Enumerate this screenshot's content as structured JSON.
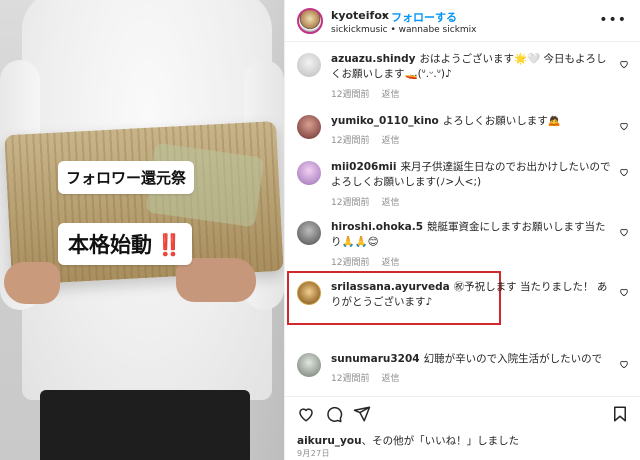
{
  "media": {
    "caption_line1": "フォロワー還元祭",
    "caption_line2": "本格始動",
    "caption_mark": "‼️"
  },
  "header": {
    "username": "kyoteifox",
    "separator": "•",
    "follow_label": "フォローする",
    "subtitle": "sickickmusic • wannabe sickmix",
    "menu_icon": "ellipsis-icon"
  },
  "comments": [
    {
      "username": "azuazu.shindy",
      "text": "おはようございます🌟🤍 今日もよろしくお願いします🚤(ᐡ.ᵕ.ᐡ)♪",
      "time": "12週間前",
      "reply": "返信",
      "avatar_color": "#d9d9d9"
    },
    {
      "username": "yumiko_0110_kino",
      "text": "よろしくお願いします🙇",
      "time": "12週間前",
      "reply": "返信",
      "avatar_color": "#8a4a4a"
    },
    {
      "username": "mii0206mii",
      "text": "来月子供達誕生日なのでお出かけしたいのでよろしくお願いします(ﾉ>人<;)",
      "time": "12週間前",
      "reply": "返信",
      "avatar_color": "#c7a0d8"
    },
    {
      "username": "hiroshi.ohoka.5",
      "text": "競艇軍資金にしますお願いします当たり🙏🙏😊",
      "time": "12週間前",
      "reply": "返信",
      "avatar_color": "#6f6f6f"
    },
    {
      "username": "srilassana.ayurveda",
      "text": "㊗予祝します 当たりました！ ありがとうございます♪",
      "time": "",
      "reply": "",
      "avatar_color": "#b58a4a"
    },
    {
      "username": "sunumaru3204",
      "text": "幻聴が辛いので入院生活がしたいので",
      "time": "12週間前",
      "reply": "返信",
      "avatar_color": "#9aa59a"
    }
  ],
  "actions": {
    "like_icon": "heart-icon",
    "comment_icon": "comment-icon",
    "share_icon": "send-icon",
    "save_icon": "bookmark-icon"
  },
  "likes": {
    "user": "aikuru_you",
    "text": "、その他が「いいね！」しました",
    "others_bold": "その他"
  },
  "date": "9月27日"
}
